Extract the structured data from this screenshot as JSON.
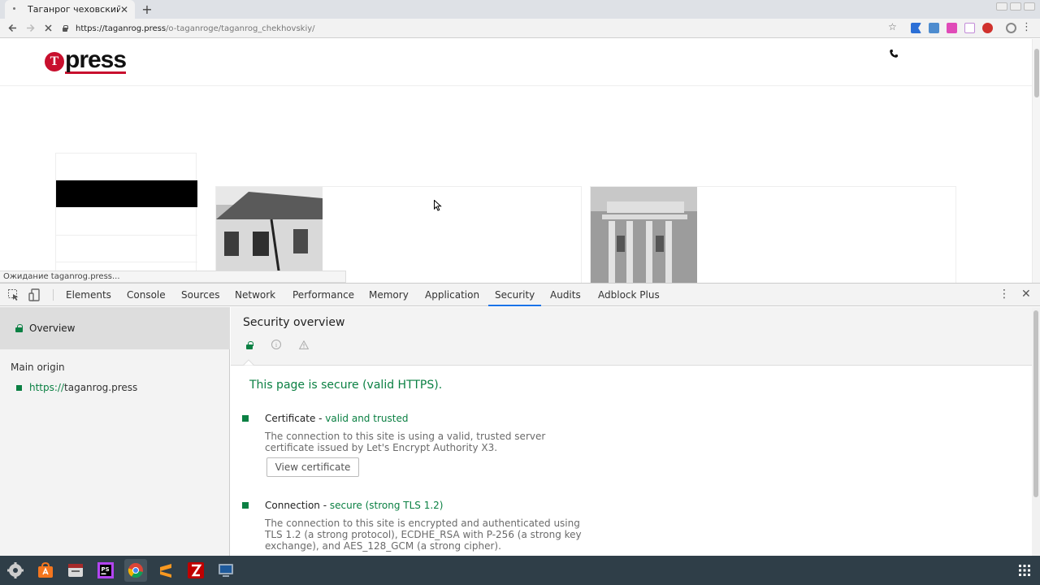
{
  "browser": {
    "tab_title": "Таганрог чеховский",
    "new_tab": "+",
    "tab_close": "✕",
    "url_host": "https://taganrog.press",
    "url_path": "/o-taganroge/taganrog_chekhovskiy/",
    "status": "Ожидание taganrog.press..."
  },
  "site": {
    "logo_mark": "T",
    "logo_word": "press"
  },
  "devtools": {
    "tabs": [
      {
        "label": "Elements"
      },
      {
        "label": "Console"
      },
      {
        "label": "Sources"
      },
      {
        "label": "Network"
      },
      {
        "label": "Performance"
      },
      {
        "label": "Memory"
      },
      {
        "label": "Application"
      },
      {
        "label": "Security",
        "active": true
      },
      {
        "label": "Audits"
      },
      {
        "label": "Adblock Plus"
      }
    ],
    "sidebar": {
      "overview": "Overview",
      "main_origin_label": "Main origin",
      "origin_scheme": "https://",
      "origin_host": "taganrog.press"
    },
    "security": {
      "title": "Security overview",
      "summary": "This page is secure (valid HTTPS).",
      "certificate": {
        "label": "Certificate - ",
        "status": "valid and trusted",
        "desc": "The connection to this site is using a valid, trusted server certificate issued by Let's Encrypt Authority X3.",
        "button": "View certificate"
      },
      "connection": {
        "label": "Connection - ",
        "status": "secure (strong TLS 1.2)",
        "desc": "The connection to this site is encrypted and authenticated using TLS 1.2 (a strong protocol), ECDHE_RSA with P-256 (a strong key exchange), and AES_128_GCM (a strong cipher)."
      }
    }
  },
  "colors": {
    "secure_green": "#0b8043",
    "brand_red": "#c8102e",
    "taskbar": "#2f3e48"
  },
  "taskbar_apps": [
    "settings-app-icon",
    "store-app-icon",
    "files-app-icon",
    "phpstorm-app-icon",
    "chrome-app-icon",
    "sublime-app-icon",
    "filezilla-app-icon",
    "vm-app-icon"
  ]
}
